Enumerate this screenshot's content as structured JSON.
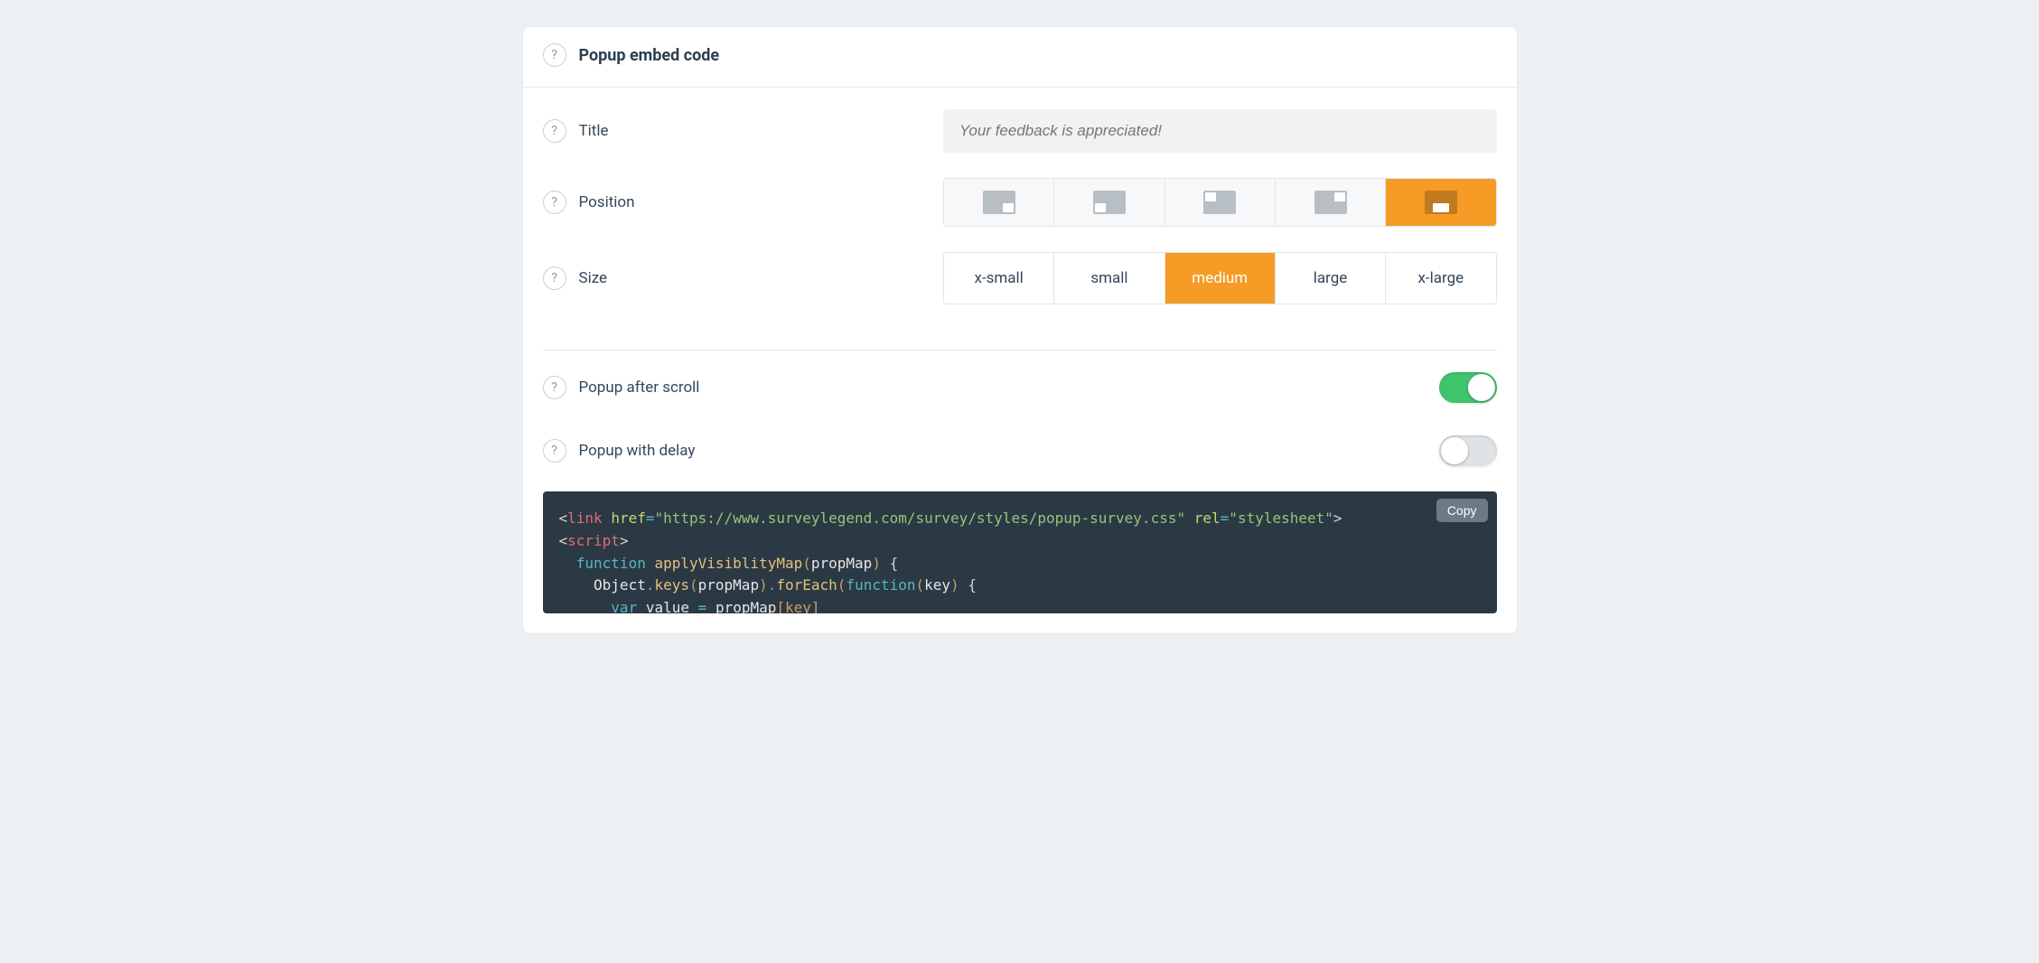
{
  "header": {
    "title": "Popup embed code"
  },
  "fields": {
    "title": {
      "label": "Title",
      "placeholder": "Your feedback is appreciated!"
    },
    "position": {
      "label": "Position",
      "options": [
        "bottom-right",
        "bottom-left",
        "top-left",
        "top-right",
        "bottom-center"
      ],
      "selected": "bottom-center"
    },
    "size": {
      "label": "Size",
      "options": [
        "x-small",
        "small",
        "medium",
        "large",
        "x-large"
      ],
      "selected": "medium"
    },
    "scroll": {
      "label": "Popup after scroll",
      "value": true
    },
    "delay": {
      "label": "Popup with delay",
      "value": false
    }
  },
  "code": {
    "copy_label": "Copy",
    "href": "https://www.surveylegend.com/survey/styles/popup-survey.css",
    "rel": "stylesheet",
    "fn_name": "applyVisiblityMap",
    "param": "propMap",
    "body_line1_pre": "Object",
    "body_line1_keys": "keys",
    "body_line1_foreach": "forEach",
    "body_line1_func": "function",
    "body_line1_key": "key",
    "partial_var": "var",
    "partial_name": "value",
    "partial_assign_lhs": "propMap",
    "partial_assign_br": "[key]"
  }
}
